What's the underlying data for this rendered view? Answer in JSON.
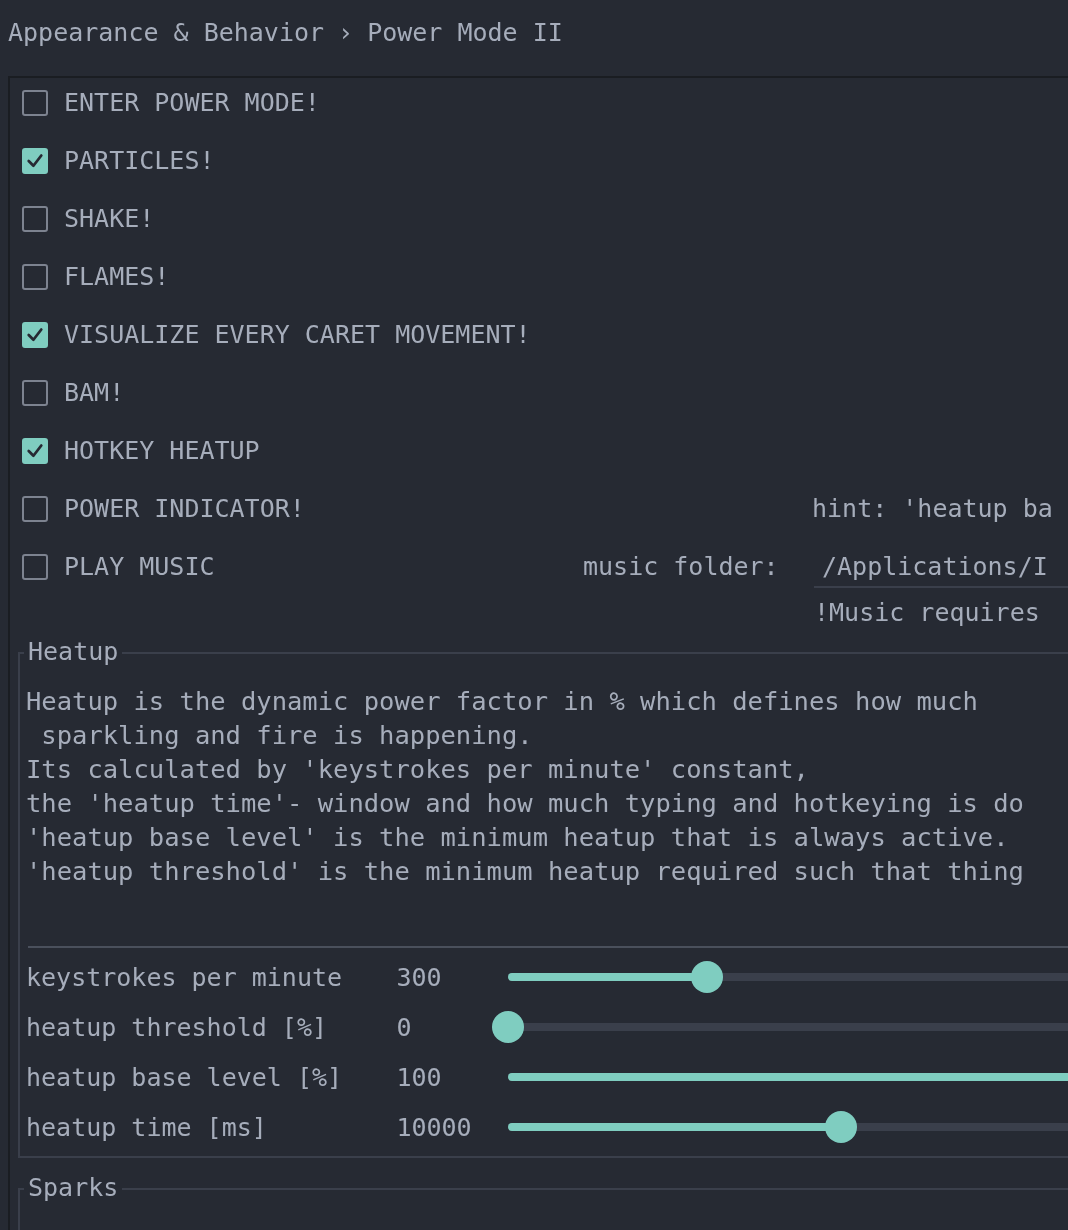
{
  "breadcrumb": {
    "parent": "Appearance & Behavior",
    "separator": "›",
    "current": "Power Mode II"
  },
  "options": [
    {
      "label": "ENTER POWER MODE!",
      "checked": false
    },
    {
      "label": "PARTICLES!",
      "checked": true
    },
    {
      "label": "SHAKE!",
      "checked": false
    },
    {
      "label": "FLAMES!",
      "checked": false
    },
    {
      "label": "VISUALIZE EVERY CARET MOVEMENT!",
      "checked": true
    },
    {
      "label": "BAM!",
      "checked": false
    },
    {
      "label": "HOTKEY HEATUP",
      "checked": true
    },
    {
      "label": "POWER INDICATOR!",
      "checked": false,
      "hint": "hint: 'heatup ba"
    },
    {
      "label": "PLAY MUSIC",
      "checked": false,
      "folder_label": "music folder:",
      "folder_value": "/Applications/I",
      "note": "!Music requires"
    }
  ],
  "heatup": {
    "title": "Heatup",
    "description": [
      "Heatup is the dynamic power factor in % which defines how much",
      " sparkling and fire is happening.",
      "Its calculated by 'keystrokes per minute' constant,",
      "the 'heatup time'- window and how much typing and hotkeying is do",
      "'heatup base level' is the minimum heatup that is always active.",
      "'heatup threshold' is the minimum heatup required such that thing"
    ],
    "sliders": [
      {
        "label": "keystrokes per minute",
        "value": "300",
        "level": 0.34
      },
      {
        "label": "heatup threshold [%]",
        "value": "0",
        "level": 0
      },
      {
        "label": "heatup base level [%]",
        "value": "100",
        "level": 1
      },
      {
        "label": "heatup time [ms]",
        "value": "10000",
        "level": 0.57
      }
    ]
  },
  "sparks": {
    "title": "Sparks"
  }
}
